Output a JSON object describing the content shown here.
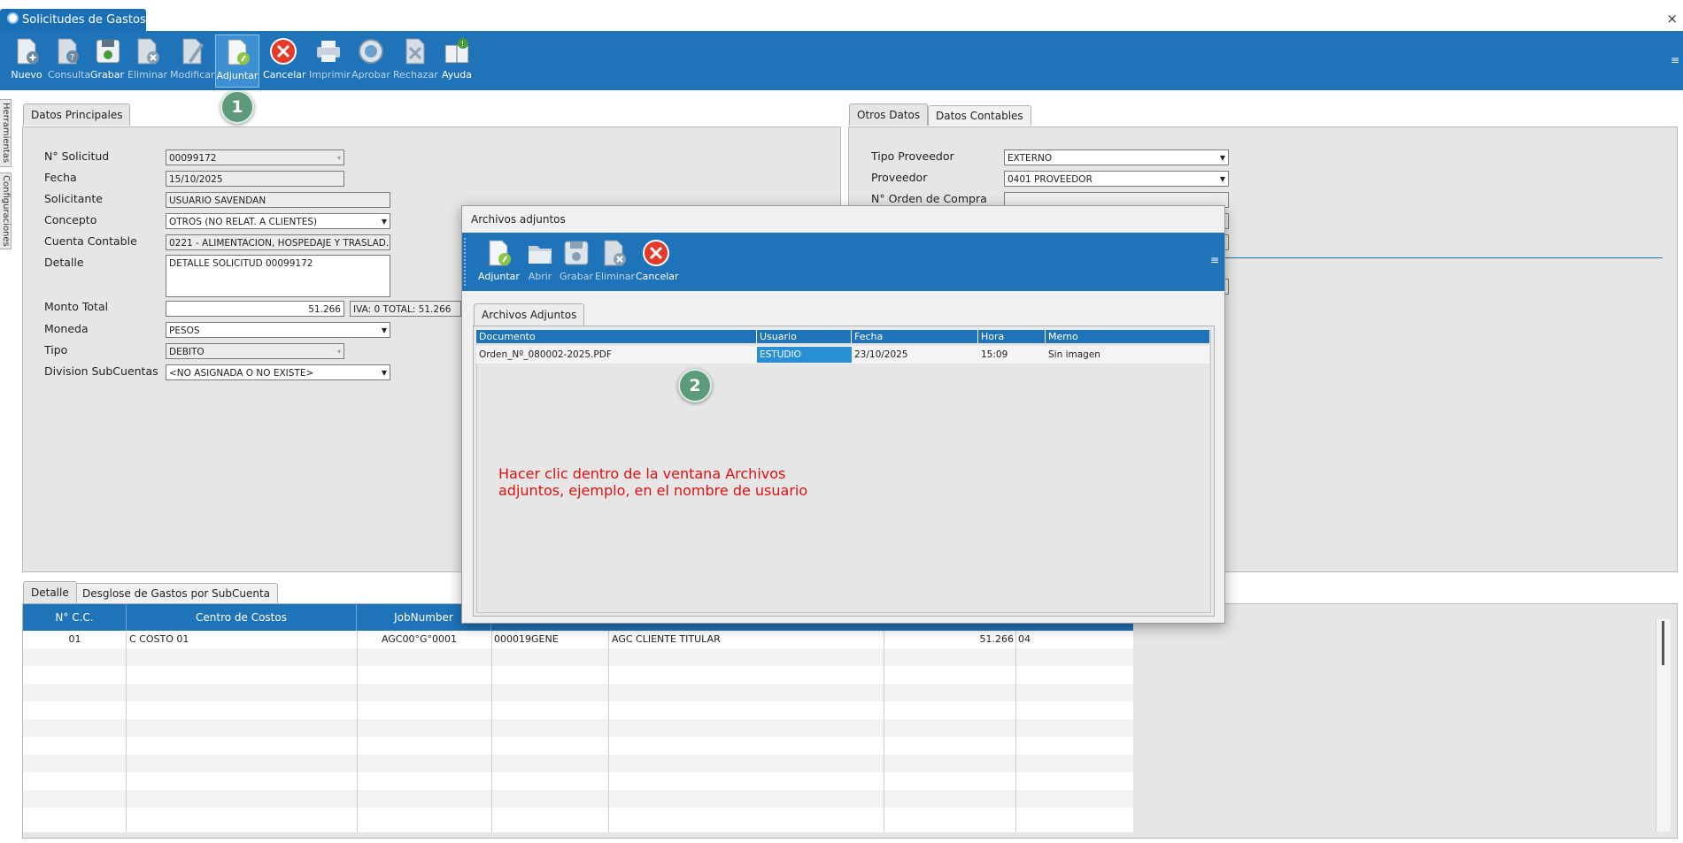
{
  "app": {
    "title": "Solicitudes de Gastos",
    "close_glyph": "×"
  },
  "toolbar": {
    "buttons": [
      {
        "label": "Nuevo",
        "icon": "new-document-icon"
      },
      {
        "label": "Consulta",
        "icon": "query-document-icon"
      },
      {
        "label": "Grabar",
        "icon": "save-icon"
      },
      {
        "label": "Eliminar",
        "icon": "delete-document-icon"
      },
      {
        "label": "Modificar",
        "icon": "edit-document-icon"
      },
      {
        "label": "Adjuntar",
        "icon": "attach-document-icon"
      },
      {
        "label": "Cancelar",
        "icon": "cancel-icon"
      },
      {
        "label": "Imprimir",
        "icon": "printer-icon"
      },
      {
        "label": "Aprobar",
        "icon": "approve-icon"
      },
      {
        "label": "Rechazar",
        "icon": "reject-icon"
      },
      {
        "label": "Ayuda",
        "icon": "help-book-icon"
      }
    ],
    "menu_glyph": "≡"
  },
  "side_tabs": {
    "herramientas": "Herramientas",
    "configuraciones": "Configuraciones"
  },
  "datos_principales": {
    "tab": "Datos Principales",
    "labels": {
      "n_solicitud": "N° Solicitud",
      "fecha": "Fecha",
      "solicitante": "Solicitante",
      "concepto": "Concepto",
      "cuenta_contable": "Cuenta Contable",
      "detalle": "Detalle",
      "monto_total": "Monto Total",
      "moneda": "Moneda",
      "tipo": "Tipo",
      "division": "Division SubCuentas"
    },
    "values": {
      "n_solicitud": "00099172",
      "fecha": "15/10/2025",
      "solicitante": "USUARIO SAVENDAN",
      "concepto": "OTROS (NO RELAT. A CLIENTES)",
      "cuenta_contable": "0221 - ALIMENTACION, HOSPEDAJE Y TRASLAD...",
      "detalle": "DETALLE SOLICITUD 00099172",
      "monto_total": "51.266",
      "iva_total": "IVA: 0 TOTAL:  51.266",
      "moneda": "PESOS",
      "tipo": "DEBITO",
      "division": "<NO ASIGNADA O NO EXISTE>"
    }
  },
  "otros_datos": {
    "tabs": [
      "Otros Datos",
      "Datos Contables"
    ],
    "labels": {
      "tipo_proveedor": "Tipo Proveedor",
      "proveedor": "Proveedor",
      "orden_compra": "N° Orden de Compra"
    },
    "values": {
      "tipo_proveedor": "EXTERNO",
      "proveedor": "0401 PROVEEDOR",
      "orden_compra": ""
    }
  },
  "detalle_tabs": [
    "Detalle",
    "Desglose de Gastos por SubCuenta"
  ],
  "detail_grid": {
    "columns": [
      "N° C.C.",
      "Centro de Costos",
      "JobNumber"
    ],
    "row": {
      "ncc": "01",
      "centro": "C COSTO 01",
      "job": "AGC00°G°0001",
      "c4": "000019GENE",
      "c5": "AGC CLIENTE TITULAR",
      "c6": "51.266",
      "c7": "04"
    }
  },
  "modal": {
    "title": "Archivos adjuntos",
    "toolbar": [
      {
        "label": "Adjuntar",
        "icon": "attach-document-icon"
      },
      {
        "label": "Abrir",
        "icon": "open-folder-icon"
      },
      {
        "label": "Grabar",
        "icon": "save-icon"
      },
      {
        "label": "Eliminar",
        "icon": "delete-document-icon"
      },
      {
        "label": "Cancelar",
        "icon": "cancel-icon"
      }
    ],
    "menu_glyph": "≡",
    "tab": "Archivos Adjuntos",
    "columns": [
      "Documento",
      "Usuario",
      "Fecha",
      "Hora",
      "Memo"
    ],
    "row": {
      "documento": "Orden_Nº_080002-2025.PDF",
      "usuario": "ESTUDIO",
      "fecha": "23/10/2025",
      "hora": "15:09",
      "memo": "Sin imagen"
    }
  },
  "annotations": {
    "badge1": "1",
    "badge2": "2",
    "instruction_line1": "Hacer clic dentro de la ventana Archivos",
    "instruction_line2": "adjuntos, ejemplo, en el nombre de usuario"
  },
  "colors": {
    "toolbar": "#1f74b9",
    "annotation": "#e01010",
    "badge": "#5c9a7b",
    "selected_cell": "#2b8fd8"
  }
}
